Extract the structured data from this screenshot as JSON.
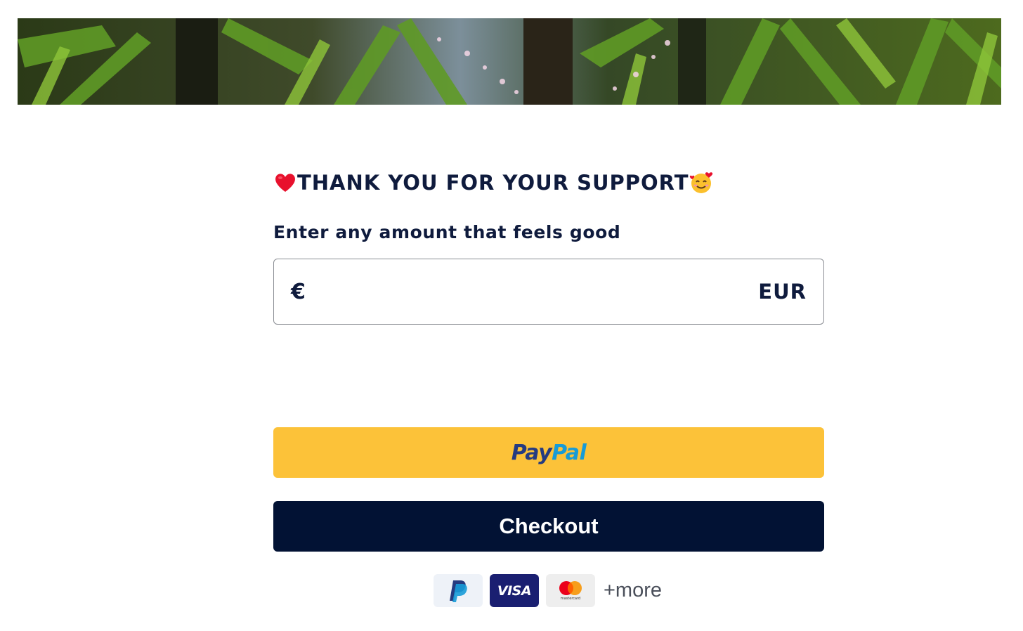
{
  "banner": {
    "image": "jungle-foliage-photo",
    "icon": "banner-image"
  },
  "header": {
    "title": "THANK YOU FOR YOUR SUPPORT",
    "leading_emoji": "red-heart-icon",
    "trailing_emoji": "smiling-face-with-hearts-icon"
  },
  "amount": {
    "label": "Enter any amount that feels good",
    "currency_symbol": "€",
    "currency_code": "EUR",
    "value": "",
    "placeholder": ""
  },
  "buttons": {
    "paypal": {
      "logo_part1": "Pay",
      "logo_part2": "Pal",
      "color": "#fcc239"
    },
    "checkout": {
      "label": "Checkout",
      "color": "#021234"
    }
  },
  "payment_methods": {
    "items": [
      {
        "name": "paypal",
        "icon": "paypal-icon"
      },
      {
        "name": "visa",
        "label": "VISA",
        "icon": "visa-icon"
      },
      {
        "name": "mastercard",
        "label": "mastercard",
        "icon": "mastercard-icon"
      }
    ],
    "more_label": "+more"
  },
  "colors": {
    "text_primary": "#0f1b3d",
    "paypal_dark": "#253b80",
    "paypal_light": "#179bd7",
    "border": "#8a8d93"
  }
}
